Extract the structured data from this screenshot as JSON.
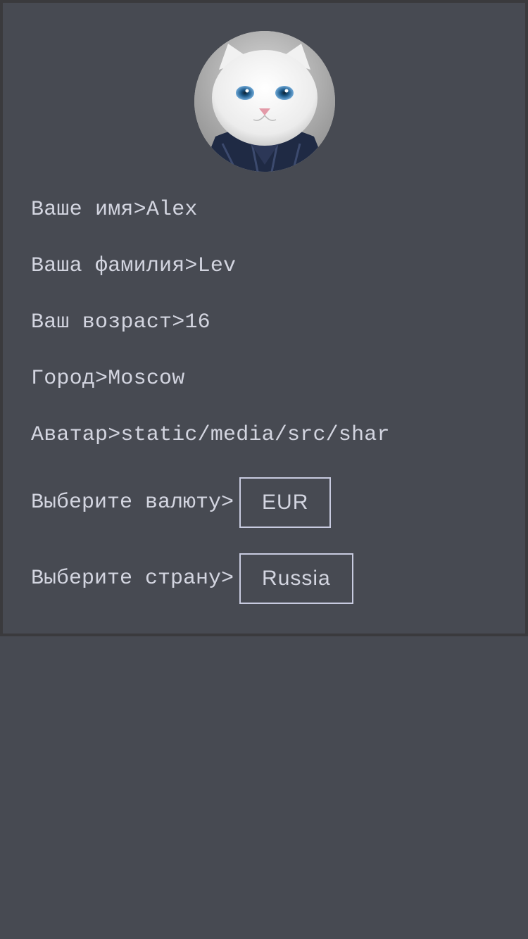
{
  "profile": {
    "first_name_label": "Ваше имя>",
    "first_name": "Alex",
    "last_name_label": "Ваша фамилия>",
    "last_name": "Lev",
    "age_label": "Ваш возраст>",
    "age": "16",
    "city_label": "Город>",
    "city": "Moscow",
    "avatar_label": "Аватар>",
    "avatar_path": "static/media/src/shar"
  },
  "currency": {
    "label": "Выберите валюту>",
    "selected": "EUR"
  },
  "country": {
    "label": "Выберите страну>",
    "selected": "Russia"
  }
}
